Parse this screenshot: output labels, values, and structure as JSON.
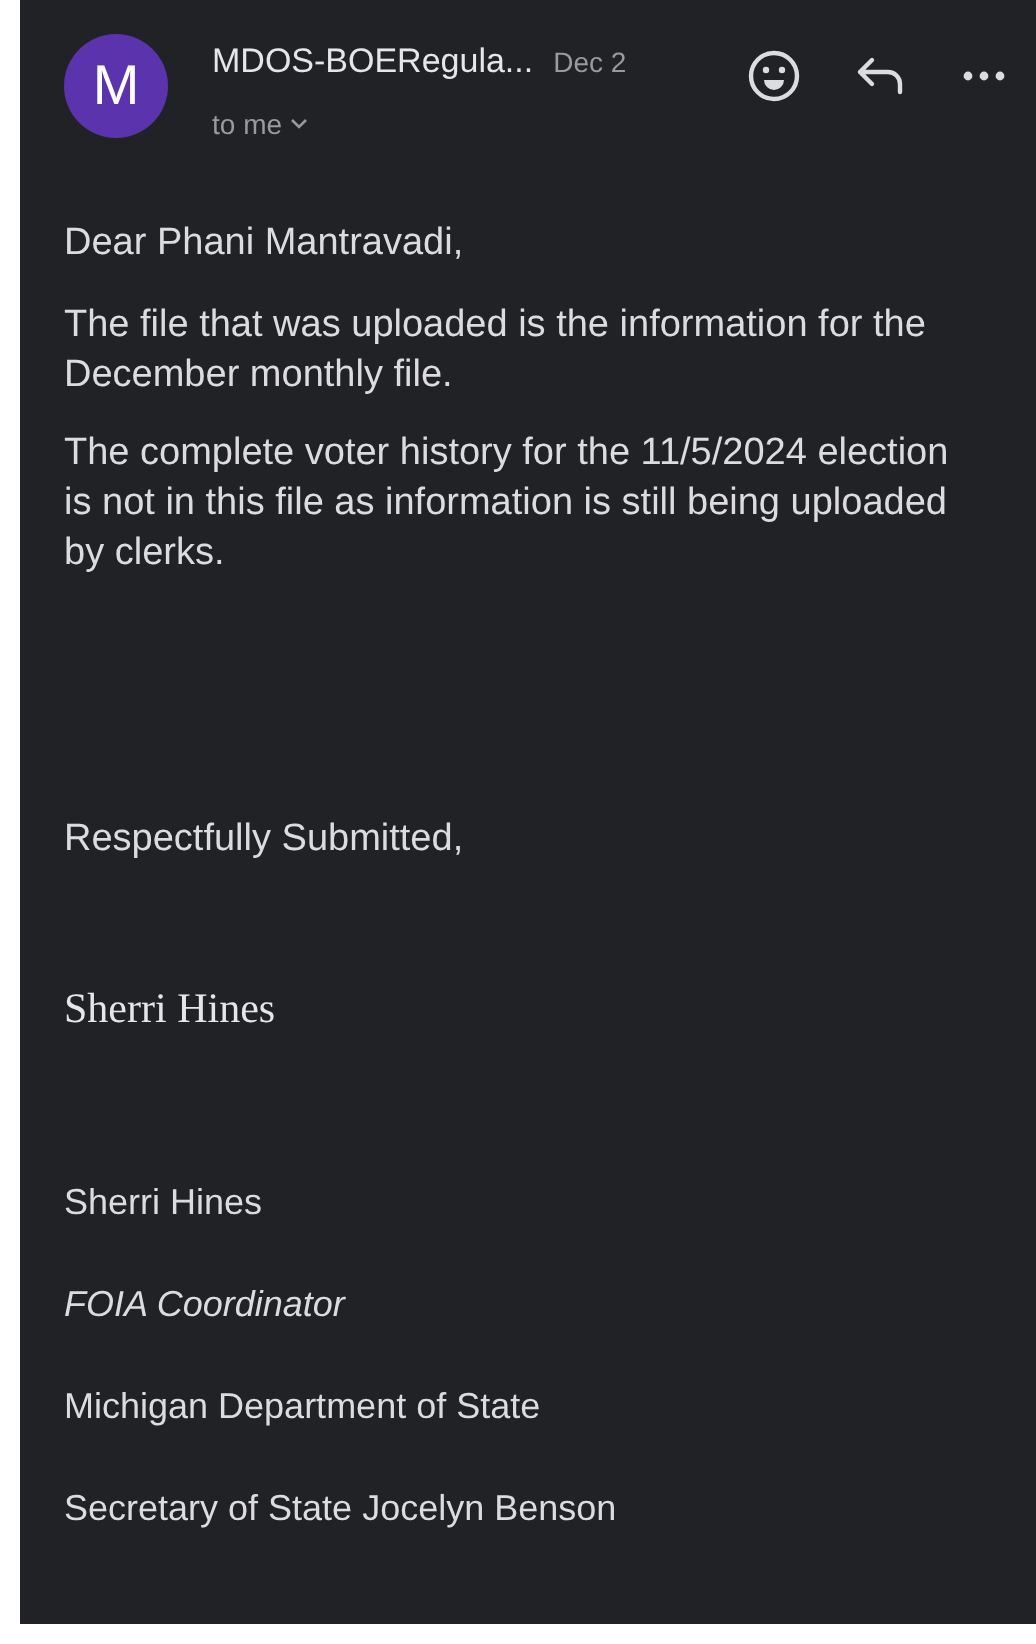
{
  "header": {
    "avatar_letter": "M",
    "sender": "MDOS-BOERegula...",
    "date": "Dec 2",
    "recipient": "to me"
  },
  "body": {
    "greeting": "Dear Phani Mantravadi,",
    "paragraphs": [
      "The file that was uploaded is the information for the December monthly file.",
      "The complete voter history for the 11/5/2024 election is not in this file as information is still being uploaded by clerks."
    ],
    "closing": "Respectfully Submitted,",
    "signature": [
      {
        "kind": "script",
        "text": "Sherri Hines"
      },
      {
        "kind": "plain",
        "text": "Sherri Hines"
      },
      {
        "kind": "italic",
        "text": "FOIA Coordinator"
      },
      {
        "kind": "plain",
        "text": "Michigan Department of State"
      },
      {
        "kind": "plain",
        "text": "Secretary of State Jocelyn Benson"
      }
    ]
  }
}
